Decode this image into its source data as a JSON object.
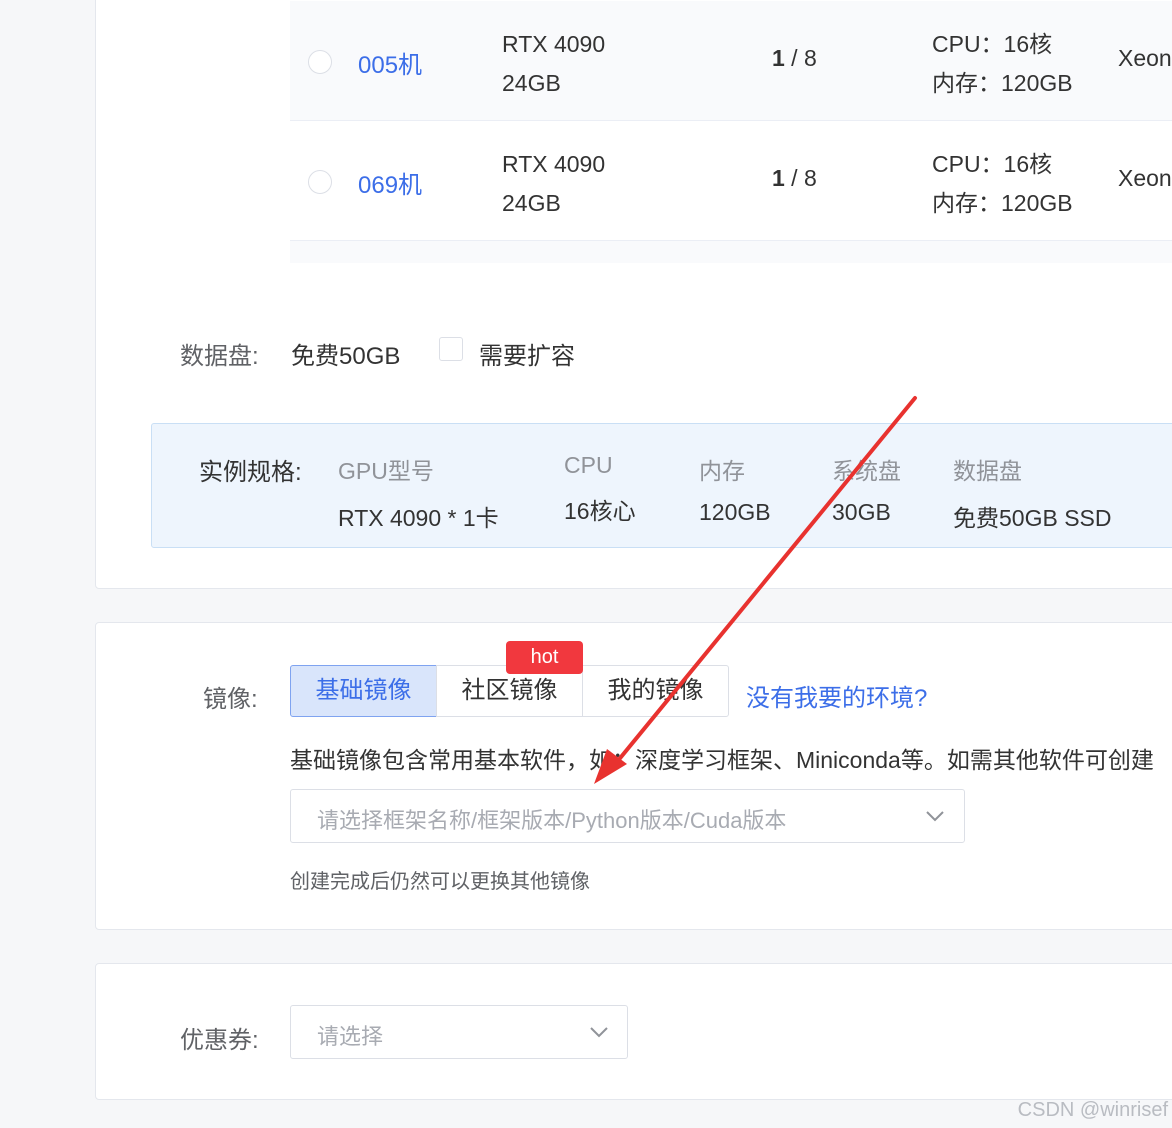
{
  "machines": [
    {
      "name": "005机",
      "gpu_model": "RTX 4090",
      "gpu_mem": "24GB",
      "gpu_free": "1",
      "gpu_total": " / 8",
      "cpu": "CPU：16核",
      "memory": "内存：120GB",
      "cpu_model": "Xeon"
    },
    {
      "name": "069机",
      "gpu_model": "RTX 4090",
      "gpu_mem": "24GB",
      "gpu_free": "1",
      "gpu_total": " / 8",
      "cpu": "CPU：16核",
      "memory": "内存：120GB",
      "cpu_model": "Xeon"
    }
  ],
  "data_disk": {
    "label": "数据盘:",
    "value": "免费50GB",
    "expand_label": "需要扩容",
    "expand_checked": false
  },
  "instance_spec": {
    "label": "实例规格:",
    "columns": [
      {
        "header": "GPU型号",
        "value": "RTX 4090 * 1卡"
      },
      {
        "header": "CPU",
        "value": "16核心"
      },
      {
        "header": "内存",
        "value": "120GB"
      },
      {
        "header": "系统盘",
        "value": "30GB"
      },
      {
        "header": "数据盘",
        "value": "免费50GB SSD"
      }
    ]
  },
  "image": {
    "label": "镜像:",
    "tabs": [
      "基础镜像",
      "社区镜像",
      "我的镜像"
    ],
    "active_tab": "基础镜像",
    "hot_badge": "hot",
    "no_env_link": "没有我要的环境?",
    "description": "基础镜像包含常用基本软件，如：深度学习框架、Miniconda等。如需其他软件可创建",
    "select_placeholder": "请选择框架名称/框架版本/Python版本/Cuda版本",
    "hint": "创建完成后仍然可以更换其他镜像"
  },
  "coupon": {
    "label": "优惠券:",
    "select_placeholder": "请选择"
  },
  "icons": {
    "select_arrow": "chevron-down-icon",
    "annotation": "red-arrow-icon"
  },
  "colors": {
    "link": "#3c6ee8",
    "hot": "#f1383e",
    "annotation": "#e8322f",
    "spec_bg": "#eef5fd"
  },
  "watermark": "CSDN @winrisef"
}
